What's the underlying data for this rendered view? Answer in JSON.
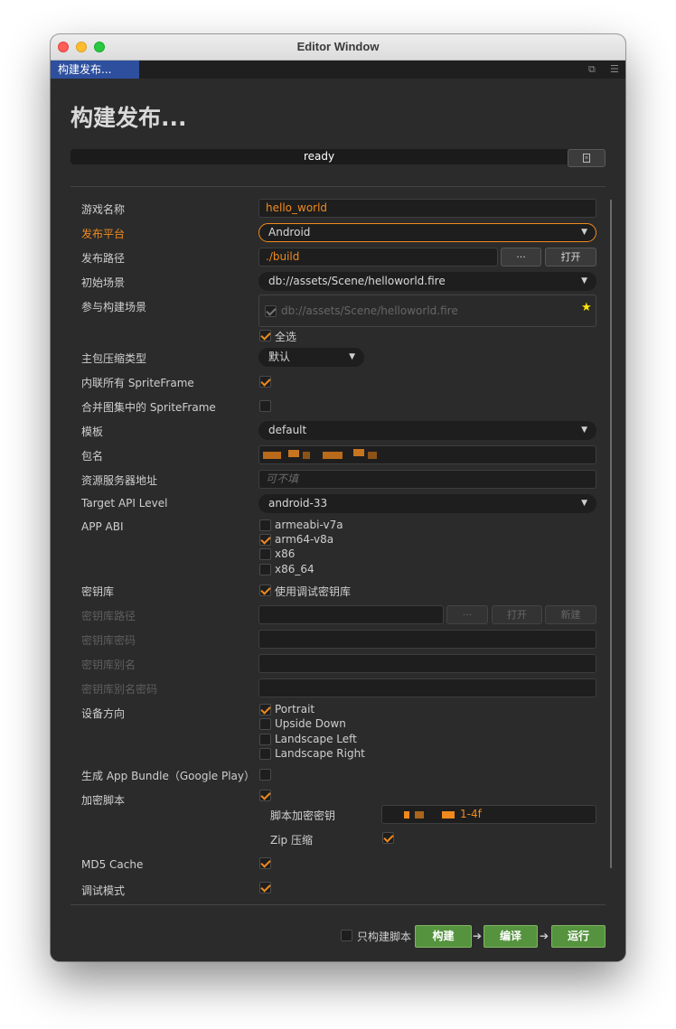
{
  "window": {
    "title": "Editor Window"
  },
  "tab": {
    "label": "构建发布..."
  },
  "heading": "构建发布...",
  "status": "ready",
  "fields": {
    "game_name": {
      "label": "游戏名称",
      "value": "hello_world"
    },
    "platform": {
      "label": "发布平台",
      "value": "Android"
    },
    "build_path": {
      "label": "发布路径",
      "value": "./build",
      "browse": "···",
      "open": "打开"
    },
    "start_scene": {
      "label": "初始场景",
      "value": "db://assets/Scene/helloworld.fire"
    },
    "scenes": {
      "label": "参与构建场景",
      "item": "db://assets/Scene/helloworld.fire",
      "select_all": "全选"
    },
    "compression": {
      "label": "主包压缩类型",
      "value": "默认"
    },
    "inline_spriteframe": {
      "label": "内联所有 SpriteFrame",
      "checked": true
    },
    "merge_spriteframe": {
      "label": "合并图集中的 SpriteFrame",
      "checked": false
    },
    "template": {
      "label": "模板",
      "value": "default"
    },
    "package_name": {
      "label": "包名"
    },
    "resource_server": {
      "label": "资源服务器地址",
      "placeholder": "可不填"
    },
    "target_api": {
      "label": "Target API Level",
      "value": "android-33"
    },
    "app_abi": {
      "label": "APP ABI",
      "options": [
        {
          "name": "armeabi-v7a",
          "checked": false
        },
        {
          "name": "arm64-v8a",
          "checked": true
        },
        {
          "name": "x86",
          "checked": false
        },
        {
          "name": "x86_64",
          "checked": false
        }
      ]
    },
    "keystore": {
      "label": "密钥库",
      "use_debug": "使用调试密钥库"
    },
    "keystore_path": {
      "label": "密钥库路径",
      "browse": "···",
      "open": "打开",
      "new": "新建"
    },
    "keystore_password": {
      "label": "密钥库密码"
    },
    "keystore_alias": {
      "label": "密钥库别名"
    },
    "keystore_alias_password": {
      "label": "密钥库别名密码"
    },
    "orientation": {
      "label": "设备方向",
      "options": [
        {
          "name": "Portrait",
          "checked": true
        },
        {
          "name": "Upside Down",
          "checked": false
        },
        {
          "name": "Landscape Left",
          "checked": false
        },
        {
          "name": "Landscape Right",
          "checked": false
        }
      ]
    },
    "app_bundle": {
      "label": "生成 App Bundle（Google Play）",
      "checked": false
    },
    "encrypt_script": {
      "label": "加密脚本",
      "checked": true
    },
    "encrypt_key": {
      "label": "脚本加密密钥",
      "value_suffix": "1-4f"
    },
    "zip": {
      "label": "Zip 压缩",
      "checked": true
    },
    "md5_cache": {
      "label": "MD5 Cache",
      "checked": true
    },
    "debug_mode": {
      "label": "调试模式",
      "checked": true
    }
  },
  "footer": {
    "only_script": "只构建脚本",
    "build": "构建",
    "compile": "编译",
    "run": "运行"
  },
  "colors": {
    "accent": "#f08a1e",
    "tab": "#2d4f9e",
    "action": "#55933e"
  }
}
